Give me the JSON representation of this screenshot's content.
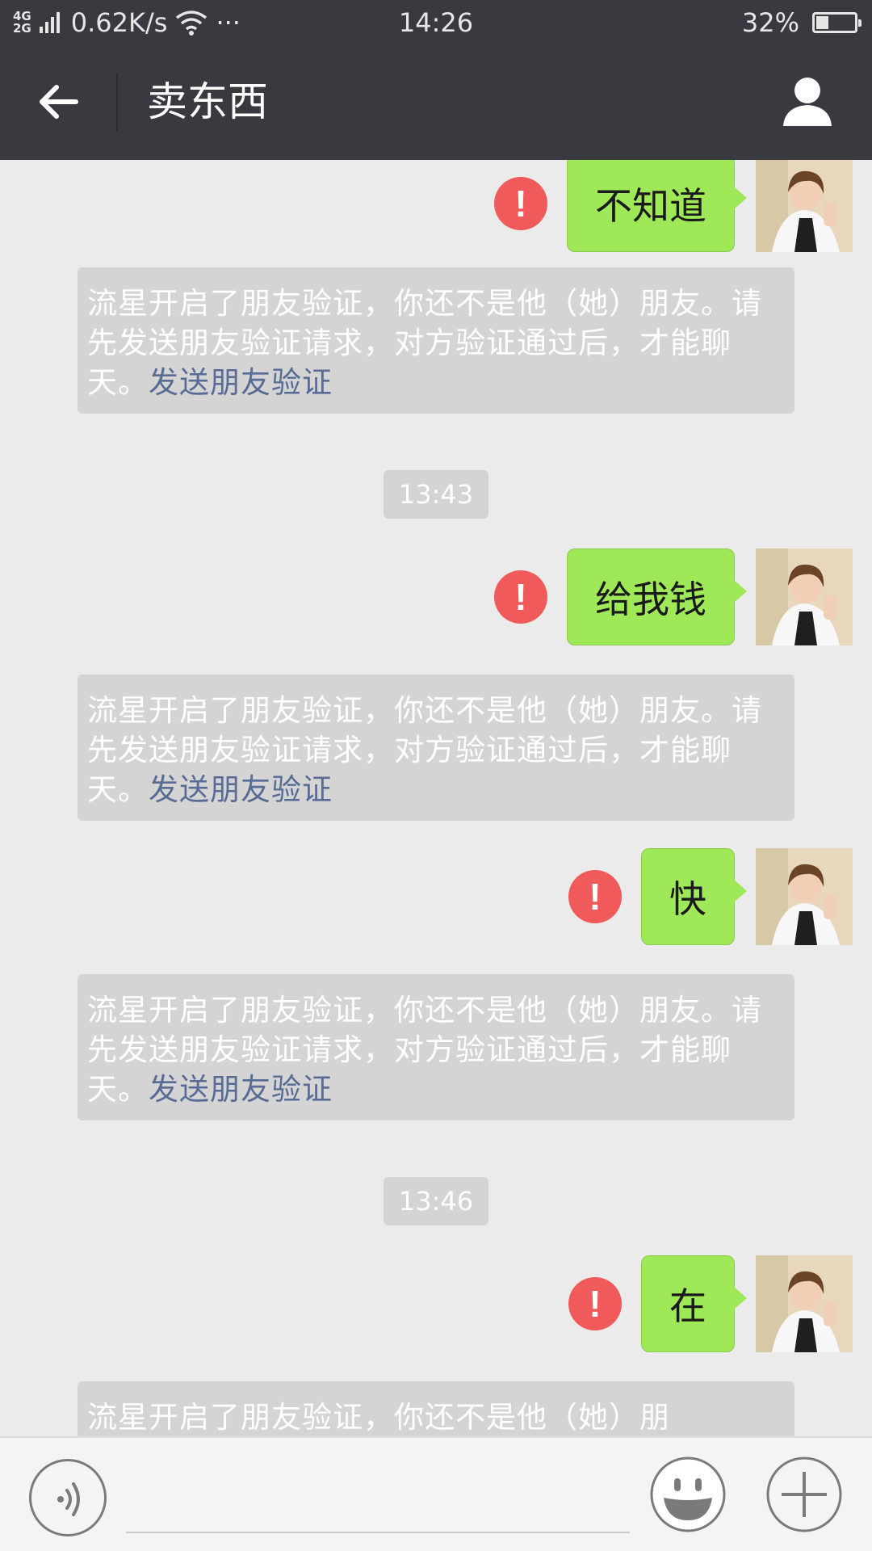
{
  "status_bar": {
    "network_top": "4G",
    "network_bottom": "2G",
    "speed": "0.62K/s",
    "dots": "···",
    "time": "14:26",
    "battery_percent": "32%",
    "battery_level": 0.32
  },
  "header": {
    "title": "卖东西",
    "back_icon": "arrow-left-icon",
    "profile_icon": "person-icon"
  },
  "messages": [
    {
      "text": "不知道",
      "status": "failed"
    },
    {
      "text": "给我钱",
      "status": "failed"
    },
    {
      "text": "快",
      "status": "failed"
    },
    {
      "text": "在",
      "status": "failed"
    }
  ],
  "system_notice": {
    "text": "流星开启了朋友验证，你还不是他（她）朋友。请先发送朋友验证请求，对方验证通过后，才能聊天。",
    "link": "发送朋友验证",
    "first_line_only": "流星开启了朋友验证，你还不是他（她）朋"
  },
  "timestamps": [
    "13:43",
    "13:46"
  ],
  "error_mark": "!",
  "input_bar": {
    "voice_icon": "voice-icon",
    "emoji_icon": "emoji-icon",
    "plus_icon": "plus-icon"
  },
  "colors": {
    "header_bg": "#393a3f",
    "bubble_bg": "#9fe858",
    "error_red": "#f05a5a",
    "link_blue": "#576b95",
    "chat_bg": "#ebebeb"
  }
}
